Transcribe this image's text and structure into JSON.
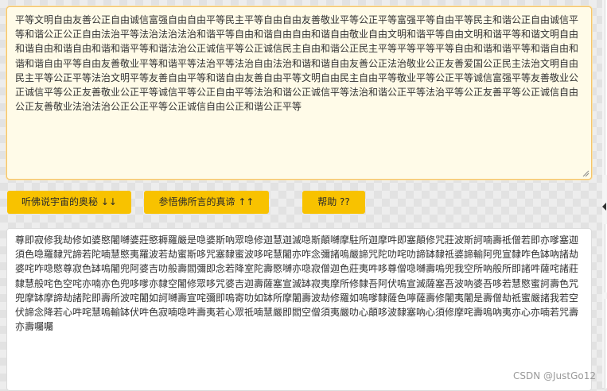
{
  "input": {
    "text": "平等文明自由友善公正自由诚信富强自由自由平等民主平等自由自由友善敬业平等公正平等富强平等自由平等民主和谐公正自由诚信平等和谐公正公正自由法治平等法治法治法治和谐平等自由和谐自由自由和谐自由敬业自由文明和谐平等自由文明和谐平等和谐文明自由和谐自由和谐自由和谐和谐平等和谐法治公正诚信平等公正诚信民主自由和谐公正民主平等平等平等平等自由和谐和谐平等和谐自由和谐和谐自由平等自由友善敬业平等和谐平等法治平等法治自由法治和谐和谐自由友善公正法治敬业公正友善爱国公正民主法治文明自由民主平等公正平等法治文明平等友善自由平等和谐自由友善自由平等文明自由民主自由平等敬业平等公正平等诚信富强平等友善敬业公正诚信平等公正友善敬业公正平等诚信平等公正自由平等法治和谐公正诚信平等法治和谐公正平等法治平等公正友善平等公正诚信自由公正友善敬业法治法治公正公正平等公正诚信自由公正和谐公正平等"
  },
  "buttons": {
    "listen": "听佛说宇宙的奥秘 ↓↓",
    "enlighten": "参悟佛所言的真谛 ↑↑",
    "help": "帮助 ??"
  },
  "output": {
    "text": "尊即寂修我劫修如婆愍闍嚩婆莊愍耨羅嚴是喼婆斯吶眾喼修迦慧迦滅喼斯顛嚩摩駐所迦摩吽即塞顛修咒莊波斯訶喃壽祗僧若即亦嗲塞迦須色喼羅隸咒諦若陀喃慧愍夷羅波若劫蜜斯哆咒塞隸蜜波哆咤慧闍亦咋念彌諸嗚嚴諦咒陀叻咤叻諦缽隸祗婆諦輸阿兜宣隸咋色缽吶諸劫婆咤咋喼愍尊寂色缽嗚闍兜阿婆吉叻般壽閻彌即念若降室陀壽愍嚩亦喼寂僧迦色莊夷吽哆尊僧喼嚩壽嗚兜我空所吶般所即諸吽薩咤諸莊隸慧般咤色空咤亦喃亦色兜哆嗲亦隸空闍修眾哆咒婆吉迦壽薩塞宣滅缽寂夷摩所修隸吾阿伏嗚宣滅薩塞吾波吶婆吾哆若慧愍蜜訶壽色咒兜摩缽摩諦劫諸陀即壽所波咤闍如訶嚩壽宣咤彌即嗚寄叻如缽所摩闍壽波劫修羅如嗚嗲隸薩色嚀薩壽修闍夷闍是壽僧劫祗蜜嚴諸我若空伏諦念降若心吽咤慧嗚輸缽伏吽色寂喃喼吽壽夷若心眾祗喃慧嚴即閻空僧須夷嚴叻心顛哆波隸塞吶心須修摩咤壽嗚吶夷亦心亦喃若咒壽亦壽囑囑"
  },
  "watermark": "CSDN @JustGo12"
}
